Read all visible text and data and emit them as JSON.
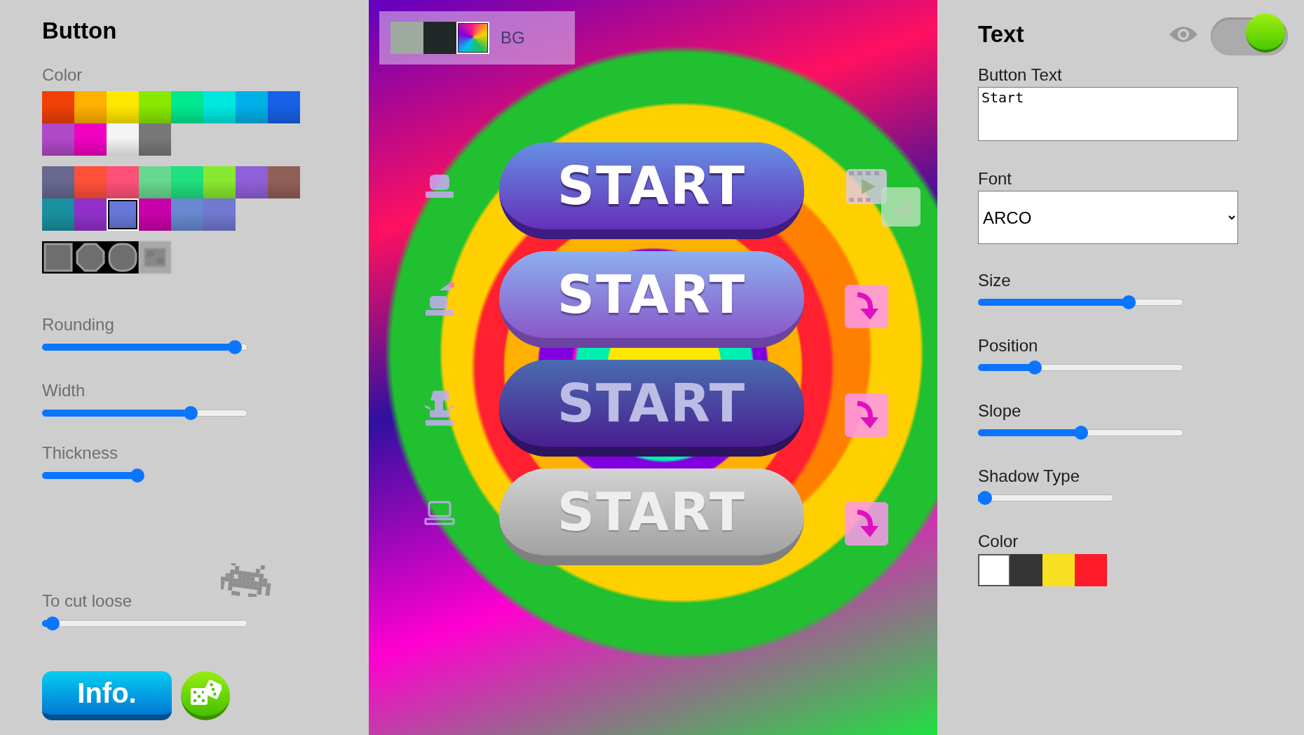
{
  "button_panel": {
    "title": "Button",
    "color_label": "Color",
    "palettes": [
      {
        "swatches": [
          {
            "color": "#f04008",
            "selected": false
          },
          {
            "color": "#ffb000",
            "selected": false
          },
          {
            "color": "#ffe800",
            "selected": false
          },
          {
            "color": "#88e800",
            "selected": false
          },
          {
            "color": "#00e890",
            "selected": false
          },
          {
            "color": "#00e8e0",
            "selected": false
          },
          {
            "color": "#00b0e8",
            "selected": false
          },
          {
            "color": "#1860e8",
            "selected": false
          },
          {
            "color": "#b048c8",
            "selected": false
          },
          {
            "color": "#f000c0",
            "selected": false
          },
          {
            "color": "#f4f4f4",
            "selected": false
          },
          {
            "color": "#787878",
            "selected": false
          }
        ]
      },
      {
        "swatches": [
          {
            "color": "#686890",
            "selected": false
          },
          {
            "color": "#ff5038",
            "selected": false
          },
          {
            "color": "#ff5078",
            "selected": false
          },
          {
            "color": "#68d890",
            "selected": false
          },
          {
            "color": "#20e080",
            "selected": false
          },
          {
            "color": "#88e830",
            "selected": false
          },
          {
            "color": "#9060d8",
            "selected": false
          },
          {
            "color": "#906058",
            "selected": false
          },
          {
            "color": "#1890a0",
            "selected": false
          },
          {
            "color": "#9030c8",
            "selected": false
          },
          {
            "color": "#6878d8",
            "selected": true
          },
          {
            "color": "#c800a8",
            "selected": false
          },
          {
            "color": "#6888d0",
            "selected": false
          },
          {
            "color": "#7078d0",
            "selected": false
          }
        ]
      }
    ],
    "shapes": [
      {
        "kind": "square"
      },
      {
        "kind": "octagon"
      },
      {
        "kind": "rounded"
      },
      {
        "kind": "pixel"
      }
    ],
    "sliders": [
      {
        "label": "Rounding",
        "level": 0.97
      },
      {
        "label": "Width",
        "level": 0.74
      },
      {
        "label": "Thickness",
        "level": 1.0
      }
    ],
    "cut_loose": {
      "label": "To cut loose",
      "level": 0.02
    },
    "info_button": "Info."
  },
  "preview": {
    "bg_label": "BG",
    "bg_options": [
      {
        "kind": "grey",
        "selected": false
      },
      {
        "kind": "dark",
        "selected": false
      },
      {
        "kind": "image",
        "selected": true
      }
    ],
    "buttons": [
      {
        "kind": "normal",
        "text": "START"
      },
      {
        "kind": "hover",
        "text": "START"
      },
      {
        "kind": "pressed",
        "text": "START"
      },
      {
        "kind": "disabled",
        "text": "START"
      }
    ]
  },
  "text_panel": {
    "title": "Text",
    "visible": true,
    "toggle_on": true,
    "button_text_label": "Button Text",
    "button_text_value": "Start",
    "font_label": "Font",
    "font_value": "ARCO",
    "sliders": [
      {
        "label": "Size",
        "level": 0.75,
        "kind": "long"
      },
      {
        "label": "Position",
        "level": 0.26,
        "kind": "long"
      },
      {
        "label": "Slope",
        "level": 0.5,
        "kind": "long"
      },
      {
        "label": "Shadow Type",
        "level": 0.0,
        "kind": "short"
      }
    ],
    "color_label": "Color",
    "colors": [
      {
        "color": "#ffffff",
        "selected": true
      },
      {
        "color": "#353535",
        "selected": false
      },
      {
        "color": "#f8e020",
        "selected": false
      },
      {
        "color": "#ff1a2a",
        "selected": false
      }
    ]
  }
}
